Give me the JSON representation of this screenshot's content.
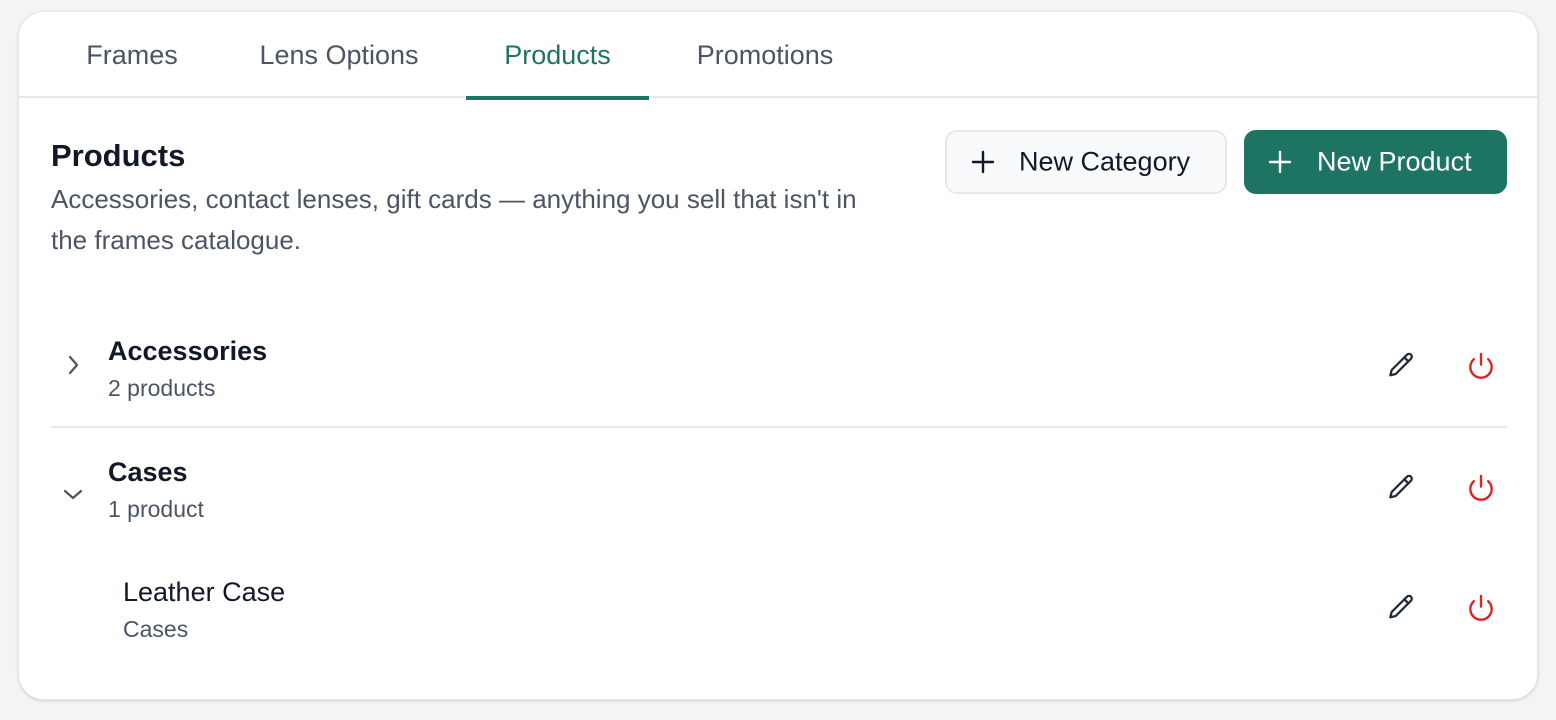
{
  "tabs": [
    {
      "label": "Frames"
    },
    {
      "label": "Lens Options"
    },
    {
      "label": "Products"
    },
    {
      "label": "Promotions"
    }
  ],
  "section": {
    "title": "Products",
    "description": "Accessories, contact lenses, gift cards — anything you sell that isn't in the frames catalogue."
  },
  "actions": {
    "new_category": "New Category",
    "new_product": "New Product"
  },
  "categories": [
    {
      "name": "Accessories",
      "count": "2 products",
      "expanded": false
    },
    {
      "name": "Cases",
      "count": "1 product",
      "expanded": true,
      "products": [
        {
          "name": "Leather Case",
          "category": "Cases"
        }
      ]
    }
  ],
  "colors": {
    "accent": "#1e7462",
    "danger": "#dc2626"
  },
  "icons": [
    "plus-icon",
    "chevron-right-icon",
    "chevron-down-icon",
    "pencil-icon",
    "power-icon"
  ]
}
